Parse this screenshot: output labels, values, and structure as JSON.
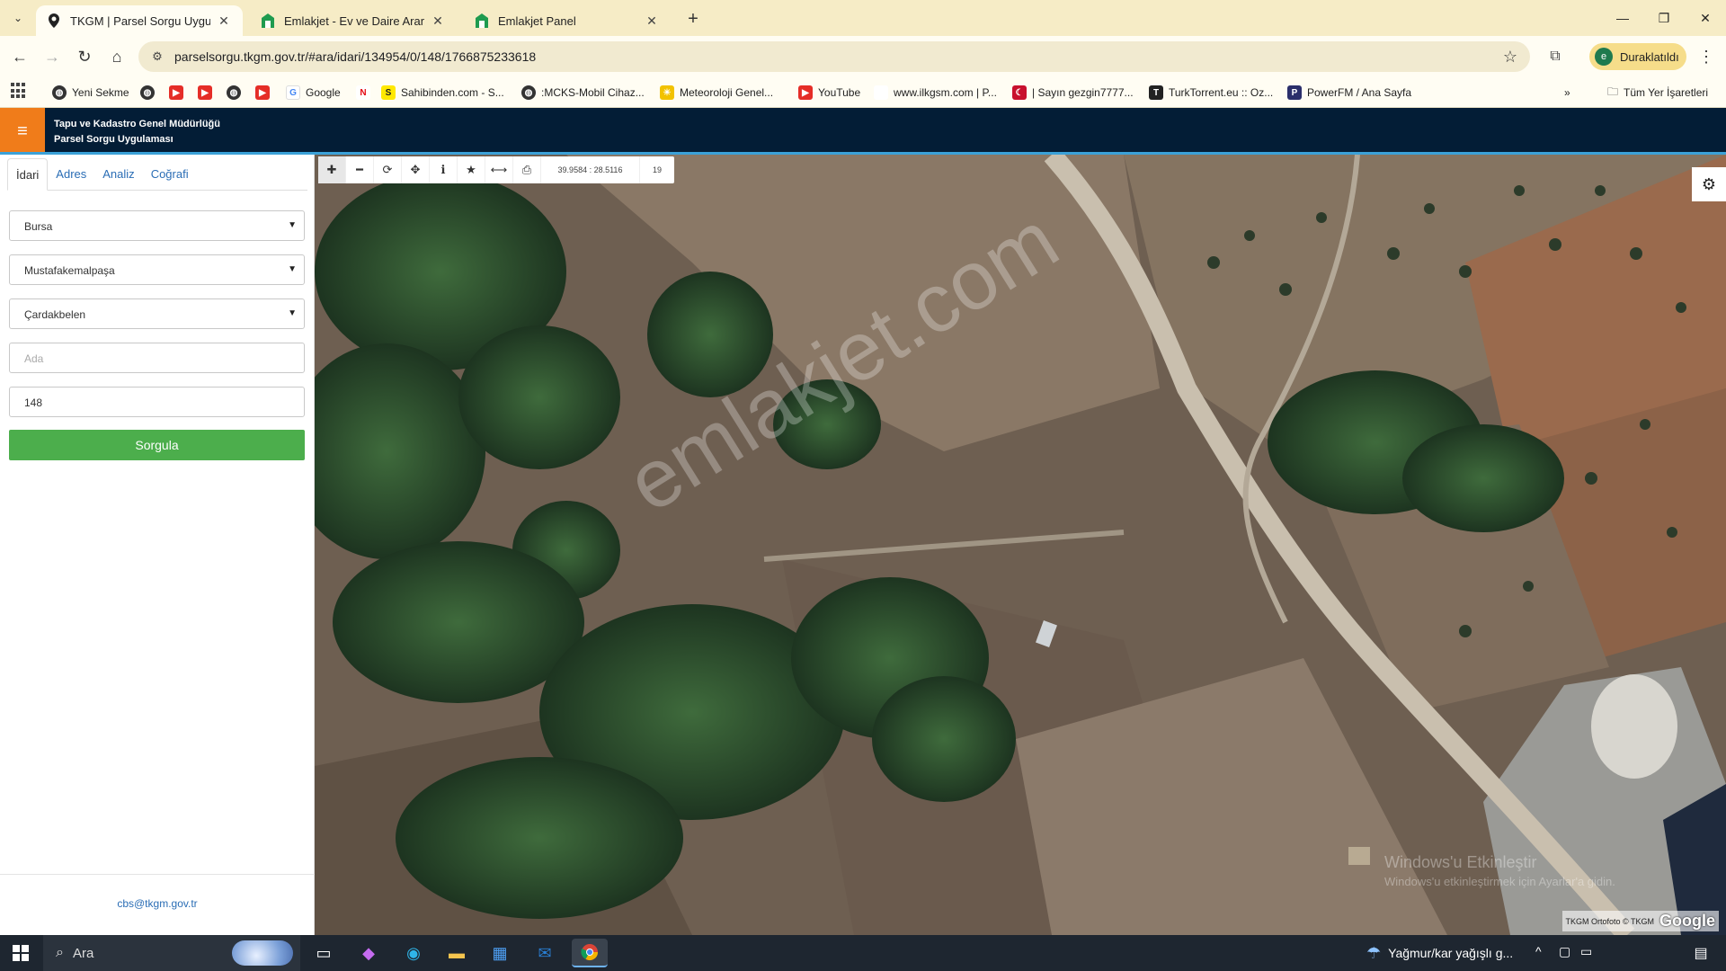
{
  "browser": {
    "tabs": [
      {
        "title": "TKGM | Parsel Sorgu Uygulamas",
        "active": true
      },
      {
        "title": "Emlakjet - Ev ve Daire Araman",
        "active": false
      },
      {
        "title": "Emlakjet Panel",
        "active": false
      }
    ],
    "url": "parselsorgu.tkgm.gov.tr/#ara/idari/134954/0/148/1766875233618",
    "profile_initial": "e",
    "profile_label": "Duraklatıldı",
    "bookmarks": [
      {
        "label": "Yeni Sekme",
        "icon": "globe-icon"
      },
      {
        "label": "",
        "icon": "globe-icon"
      },
      {
        "label": "",
        "icon": "youtube-icon"
      },
      {
        "label": "",
        "icon": "youtube-icon"
      },
      {
        "label": "",
        "icon": "globe-icon"
      },
      {
        "label": "",
        "icon": "youtube-icon"
      },
      {
        "label": "Google",
        "icon": "google-icon"
      },
      {
        "label": "",
        "icon": "netflix-icon"
      },
      {
        "label": "Sahibinden.com - S...",
        "icon": "sahibinden-icon"
      },
      {
        "label": ":MCKS-Mobil Cihaz...",
        "icon": "globe-icon"
      },
      {
        "label": "Meteoroloji Genel...",
        "icon": "meteoroloji-icon"
      },
      {
        "label": "YouTube",
        "icon": "youtube-icon"
      },
      {
        "label": "www.ilkgsm.com | P...",
        "icon": "blank-icon"
      },
      {
        "label": "| Sayın gezgin7777...",
        "icon": "flag-icon"
      },
      {
        "label": "TurkTorrent.eu :: Oz...",
        "icon": "torrent-icon"
      },
      {
        "label": "PowerFM / Ana Sayfa",
        "icon": "powerfm-icon"
      }
    ],
    "all_bookmarks_label": "Tüm Yer İşaretleri"
  },
  "app": {
    "title_line1": "Tapu ve Kadastro Genel Müdürlüğü",
    "title_line2": "Parsel Sorgu Uygulaması",
    "accent_color": "#f07c1a",
    "header_color": "#031d36"
  },
  "left_panel": {
    "tabs": [
      "İdari",
      "Adres",
      "Analiz",
      "Coğrafi"
    ],
    "active_tab": "İdari",
    "il": "Bursa",
    "ilce": "Mustafakemalpaşa",
    "mahalle": "Çardakbelen",
    "ada_placeholder": "Ada",
    "parsel_value": "148",
    "submit_label": "Sorgula",
    "footer_email": "cbs@tkgm.gov.tr"
  },
  "map": {
    "coords": "39.9584 : 28.5116",
    "zoom": "19",
    "watermark": "emlakjet.com",
    "windows_activation_line1": "Windows'u Etkinleştir",
    "windows_activation_line2": "Windows'u etkinleştirmek için Ayarlar'a gidin.",
    "attribution": "TKGM Ortofoto © TKGM",
    "provider_logo": "Google"
  },
  "taskbar": {
    "search_label": "Ara",
    "weather_text": "Yağmur/kar yağışlı g..."
  }
}
